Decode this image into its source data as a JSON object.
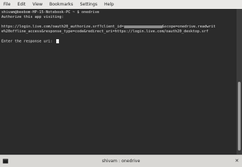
{
  "menubar": {
    "items": [
      {
        "label": "File"
      },
      {
        "label": "Edit"
      },
      {
        "label": "View"
      },
      {
        "label": "Bookmarks"
      },
      {
        "label": "Settings"
      },
      {
        "label": "Help"
      }
    ]
  },
  "terminal": {
    "prompt_user": "shivam@beebom-HP-15-Notebook-PC",
    "prompt_path": " ~ $ ",
    "command": "onedrive",
    "line2": "Authorize this app visiting:",
    "url_part1": "https://login.live.com/oauth20_authorize.srf?client_id=",
    "url_part2": "&scope=onedrive.readwrit",
    "url_line2": "e%20offline_access&response_type=code&redirect_uri=https://login.live.com/oauth20_desktop.srf",
    "response_prompt": "Enter the response uri: "
  },
  "tab": {
    "title": "shivam : onedrive",
    "icon": "terminal-icon",
    "close_icon": "close-icon",
    "close_glyph": "✕"
  },
  "colors": {
    "terminal_bg": "#2b2b2b",
    "terminal_fg": "#e6e6e6",
    "menubar_bg": "#e9e8e6"
  }
}
